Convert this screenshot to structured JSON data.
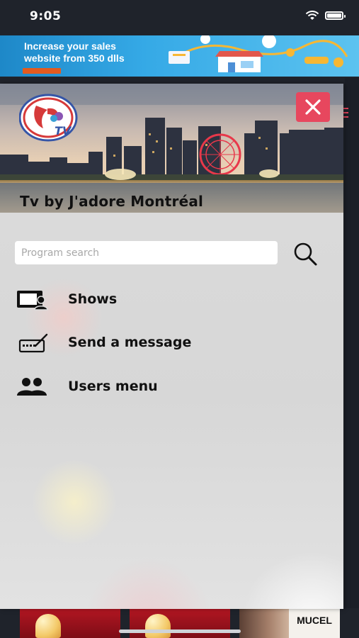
{
  "status_bar": {
    "time": "9:05"
  },
  "ad": {
    "line1": "Increase your sales",
    "line2": "website from 350 dlls",
    "accent": "#e25b1f"
  },
  "drawer": {
    "title": "Tv by J'adore Montréal",
    "logo_text": "TV",
    "close_icon": "close-icon",
    "accent": "#e7475e"
  },
  "search": {
    "placeholder": "Program search",
    "value": ""
  },
  "menu": [
    {
      "label": "Shows",
      "icon": "tv-user-icon"
    },
    {
      "label": "Send a message",
      "icon": "keyboard-pen-icon"
    },
    {
      "label": "Users menu",
      "icon": "users-icon"
    }
  ],
  "bottom_thumbs": {
    "text_thumb": "MUCEL"
  }
}
